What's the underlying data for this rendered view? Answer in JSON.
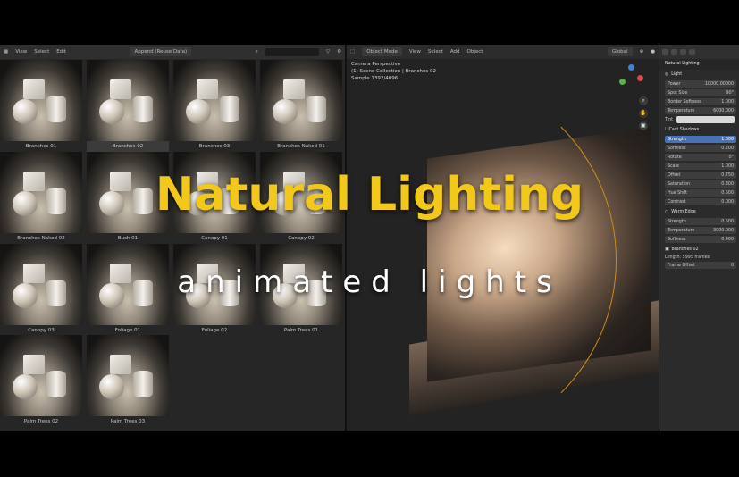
{
  "asset_browser": {
    "menu": [
      "View",
      "Select",
      "Edit"
    ],
    "import_mode": "Append (Reuse Data)",
    "assets": [
      {
        "name": "Branches 01"
      },
      {
        "name": "Branches 02"
      },
      {
        "name": "Branches 03"
      },
      {
        "name": "Branches Naked 01"
      },
      {
        "name": "Branches Naked 02"
      },
      {
        "name": "Bush 01"
      },
      {
        "name": "Canopy 01"
      },
      {
        "name": "Canopy 02"
      },
      {
        "name": "Canopy 03"
      },
      {
        "name": "Foliage 01"
      },
      {
        "name": "Foliage 02"
      },
      {
        "name": "Palm Trees 01"
      },
      {
        "name": "Palm Trees 02"
      },
      {
        "name": "Palm Trees 03"
      }
    ]
  },
  "viewport": {
    "mode": "Object Mode",
    "menu": [
      "View",
      "Select",
      "Add",
      "Object"
    ],
    "transform": "Global",
    "info": {
      "line1": "Camera Perspective",
      "line2": "(1) Scene Collection | Branches 02",
      "line3": "Sample 1392/4096"
    }
  },
  "properties": {
    "title": "Natural Lighting",
    "light": {
      "label": "Light",
      "power": {
        "label": "Power",
        "value": "10000.00000"
      },
      "spot_size": {
        "label": "Spot Size",
        "value": "90°"
      },
      "border_softness": {
        "label": "Border Softness",
        "value": "1.000"
      },
      "temperature": {
        "label": "Temperature",
        "value": "6000.000"
      },
      "tint_label": "Tint"
    },
    "cast_shadows": {
      "label": "Cast Shadows",
      "rows": [
        {
          "label": "Strength",
          "value": "1.000"
        },
        {
          "label": "Softness",
          "value": "0.200"
        },
        {
          "label": "Rotate",
          "value": "0°"
        },
        {
          "label": "Scale",
          "value": "1.000"
        },
        {
          "label": "Offset",
          "value": "0.750"
        },
        {
          "label": "Saturation",
          "value": "0.300"
        },
        {
          "label": "Hue Shift",
          "value": "0.500"
        },
        {
          "label": "Contrast",
          "value": "0.000"
        }
      ]
    },
    "warm_edge": {
      "label": "Warm Edge",
      "rows": [
        {
          "label": "Strength",
          "value": "0.500"
        },
        {
          "label": "Temperature",
          "value": "3000.000"
        },
        {
          "label": "Softness",
          "value": "0.400"
        }
      ]
    },
    "object": {
      "label": "Branches 02",
      "length": "Length: 5995 frames",
      "frame_offset": {
        "label": "Frame Offset",
        "value": "0"
      }
    }
  },
  "overlay": {
    "title": "Natural Lighting",
    "subtitle": "animated lights"
  },
  "colors": {
    "title": "#f2c81a",
    "accent": "#4772b3"
  }
}
